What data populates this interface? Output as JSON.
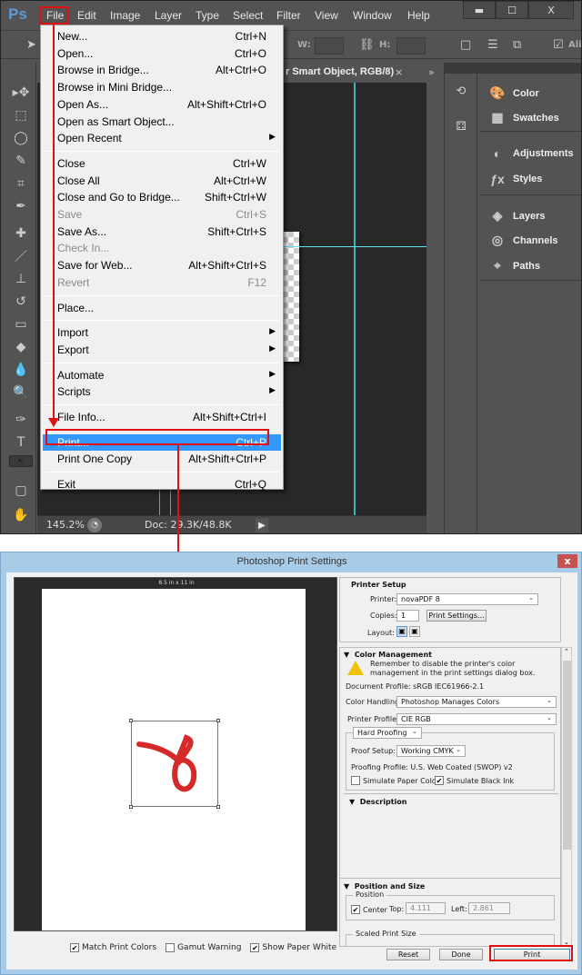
{
  "photoshop": {
    "logo": "Ps",
    "menus": [
      "File",
      "Edit",
      "Image",
      "Layer",
      "Type",
      "Select",
      "Filter",
      "View",
      "Window",
      "Help"
    ],
    "window_buttons": {
      "minimize": "▬",
      "maximize": "☐",
      "close": "X"
    },
    "options_bar": {
      "w_label": "W:",
      "h_label": "H:",
      "align_label": "Ali"
    },
    "doc_tab": {
      "title": "r Smart Object, RGB/8)",
      "close": "×",
      "more": "»"
    },
    "tools": [
      "move-tool",
      "marquee-tool",
      "lasso-tool",
      "quick-selection-tool",
      "crop-tool",
      "eyedropper-tool",
      "healing-brush-tool",
      "brush-tool",
      "clone-stamp-tool",
      "history-brush-tool",
      "eraser-tool",
      "paint-bucket-tool",
      "blur-tool",
      "dodge-tool",
      "pen-tool",
      "type-tool",
      "path-selection-tool",
      "shape-tool",
      "hand-tool"
    ],
    "panels": [
      {
        "label": "Color",
        "icon": "palette-icon"
      },
      {
        "label": "Swatches",
        "icon": "swatches-icon"
      },
      {
        "label": "Adjustments",
        "icon": "adjustments-icon"
      },
      {
        "label": "Styles",
        "icon": "styles-icon"
      },
      {
        "label": "Layers",
        "icon": "layers-icon"
      },
      {
        "label": "Channels",
        "icon": "channels-icon"
      },
      {
        "label": "Paths",
        "icon": "paths-icon"
      }
    ],
    "status": {
      "zoom": "145.2%",
      "doc": "Doc: 29.3K/48.8K"
    },
    "file_menu": [
      {
        "label": "New...",
        "shortcut": "Ctrl+N"
      },
      {
        "label": "Open...",
        "shortcut": "Ctrl+O"
      },
      {
        "label": "Browse in Bridge...",
        "shortcut": "Alt+Ctrl+O"
      },
      {
        "label": "Browse in Mini Bridge...",
        "shortcut": ""
      },
      {
        "label": "Open As...",
        "shortcut": "Alt+Shift+Ctrl+O"
      },
      {
        "label": "Open as Smart Object...",
        "shortcut": ""
      },
      {
        "label": "Open Recent",
        "shortcut": "",
        "submenu": true
      },
      {
        "label": "Close",
        "shortcut": "Ctrl+W"
      },
      {
        "label": "Close All",
        "shortcut": "Alt+Ctrl+W"
      },
      {
        "label": "Close and Go to Bridge...",
        "shortcut": "Shift+Ctrl+W"
      },
      {
        "label": "Save",
        "shortcut": "Ctrl+S",
        "disabled": true
      },
      {
        "label": "Save As...",
        "shortcut": "Shift+Ctrl+S"
      },
      {
        "label": "Check In...",
        "shortcut": "",
        "disabled": true
      },
      {
        "label": "Save for Web...",
        "shortcut": "Alt+Shift+Ctrl+S"
      },
      {
        "label": "Revert",
        "shortcut": "F12",
        "disabled": true
      },
      {
        "label": "Place...",
        "shortcut": ""
      },
      {
        "label": "Import",
        "shortcut": "",
        "submenu": true
      },
      {
        "label": "Export",
        "shortcut": "",
        "submenu": true
      },
      {
        "label": "Automate",
        "shortcut": "",
        "submenu": true
      },
      {
        "label": "Scripts",
        "shortcut": "",
        "submenu": true
      },
      {
        "label": "File Info...",
        "shortcut": "Alt+Shift+Ctrl+I"
      },
      {
        "label": "Print...",
        "shortcut": "Ctrl+P",
        "highlighted": true
      },
      {
        "label": "Print One Copy",
        "shortcut": "Alt+Shift+Ctrl+P"
      },
      {
        "label": "Exit",
        "shortcut": "Ctrl+Q"
      }
    ]
  },
  "print_dialog": {
    "title": "Photoshop Print Settings",
    "close": "x",
    "paper_size": "8.5 in x 11 in",
    "preview_options": [
      {
        "label": "Match Print Colors",
        "checked": true
      },
      {
        "label": "Gamut Warning",
        "checked": false
      },
      {
        "label": "Show Paper White",
        "checked": true
      }
    ],
    "printer_setup": {
      "title": "Printer Setup",
      "printer_label": "Printer:",
      "printer_value": "novaPDF 8",
      "copies_label": "Copies:",
      "copies_value": "1",
      "print_settings_btn": "Print Settings...",
      "layout_label": "Layout:"
    },
    "color_management": {
      "title": "Color Management",
      "warning": "Remember to disable the printer's color management in the print settings dialog box.",
      "document_profile": "Document Profile: sRGB IEC61966-2.1",
      "color_handling_label": "Color Handling:",
      "color_handling_value": "Photoshop Manages Colors",
      "printer_profile_label": "Printer Profile:",
      "printer_profile_value": "CIE RGB",
      "proofing_mode": "Hard Proofing",
      "proof_setup_label": "Proof Setup:",
      "proof_setup_value": "Working CMYK",
      "proofing_profile": "Proofing Profile: U.S. Web Coated (SWOP) v2",
      "simulate_paper": {
        "label": "Simulate Paper Color",
        "checked": false
      },
      "simulate_ink": {
        "label": "Simulate Black Ink",
        "checked": true
      }
    },
    "description_title": "Description",
    "position_size": {
      "title": "Position and Size",
      "position_label": "Position",
      "center": {
        "label": "Center",
        "checked": true
      },
      "top_label": "Top:",
      "top_value": "4.111",
      "left_label": "Left:",
      "left_value": "2.861",
      "scaled_label": "Scaled Print Size"
    },
    "buttons": {
      "reset": "Reset",
      "done": "Done",
      "print": "Print"
    }
  },
  "colors": {
    "annotation": "#e01010",
    "highlight": "#3399ff",
    "guide": "#3fb3b3"
  }
}
